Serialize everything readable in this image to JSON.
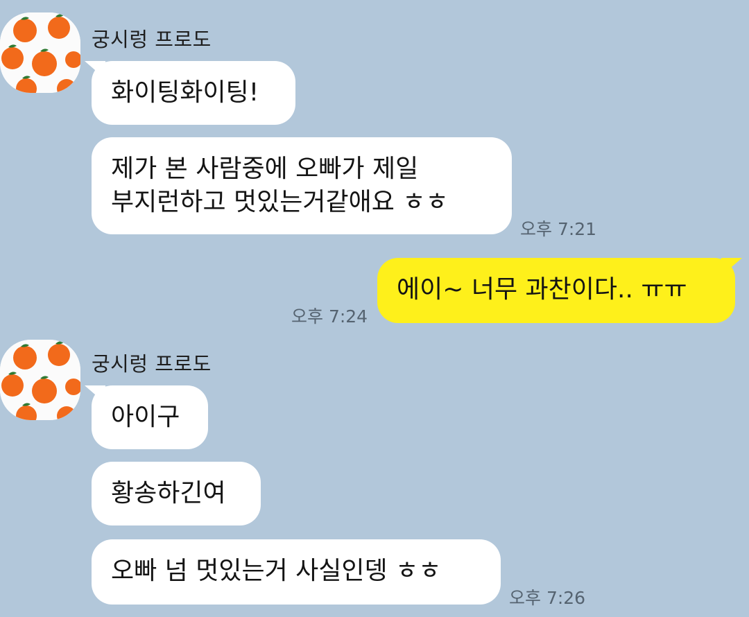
{
  "chat": {
    "sender_name": "궁시렁 프로도",
    "groups": [
      {
        "messages": [
          {
            "text": "화이팅화이팅!"
          },
          {
            "line1": "제가 본 사람중에 오빠가 제일",
            "line2": "부지런하고 멋있는거같애요 ㅎㅎ",
            "time": "오후 7:21"
          }
        ]
      },
      {
        "outgoing": {
          "text": "에이~ 너무 과찬이다.. ㅠㅠ",
          "time": "오후 7:24"
        }
      },
      {
        "messages": [
          {
            "text": "아이구"
          },
          {
            "text": "황송하긴여"
          },
          {
            "text": "오빠 넘 멋있는거 사실인뎅 ㅎㅎ",
            "time": "오후 7:26"
          }
        ]
      }
    ]
  },
  "colors": {
    "background": "#b2c7da",
    "incoming_bubble": "#ffffff",
    "outgoing_bubble": "#fef01b",
    "avatar_fruit": "#f26a1b",
    "avatar_leaf": "#2f7a33"
  },
  "icons": {
    "avatar": "tangerine-pattern-avatar"
  }
}
